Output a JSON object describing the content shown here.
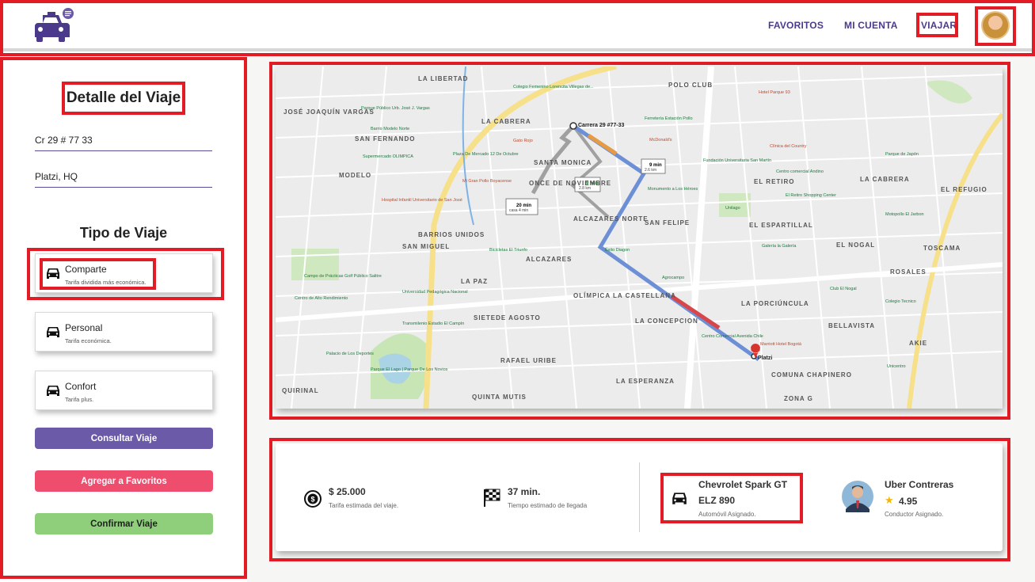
{
  "header": {
    "nav": [
      "FAVORITOS",
      "MI CUENTA",
      "VIAJAR"
    ]
  },
  "sidebar": {
    "title": "Detalle del Viaje",
    "origin": "Cr 29 # 77 33",
    "destination": "Platzi, HQ",
    "trip_type_title": "Tipo de Viaje",
    "trip_types": [
      {
        "name": "Comparte",
        "desc": "Tarifa dividida más económica."
      },
      {
        "name": "Personal",
        "desc": "Tarifa económica."
      },
      {
        "name": "Confort",
        "desc": "Tarifa plus."
      }
    ],
    "buttons": {
      "consultar": "Consultar Viaje",
      "favoritos": "Agregar a Favoritos",
      "confirmar": "Confirmar Viaje"
    },
    "colors": {
      "consultar": "#6a5aa8",
      "favoritos": "#ee4d6d",
      "confirmar": "#8fcf7c"
    }
  },
  "map": {
    "origin_label": "Carrera 29 #77-33",
    "destination_label": "Platzi",
    "route_badges": [
      {
        "time": "9 min",
        "dist": "2.6 km"
      },
      {
        "time": "9 min",
        "dist": "2.8 km"
      },
      {
        "time": "20 min",
        "dist": "casa 4 min"
      }
    ],
    "neighborhoods": [
      "LA LIBERTAD",
      "POLO CLUB",
      "JOSÉ JOAQUÍN VARGAS",
      "LA CABRERA",
      "SAN FERNANDO",
      "SANTA MONICA",
      "ONCE DE NOVIEMBRE",
      "ALCAZARES NORTE",
      "SAN FELIPE",
      "EL RETIRO",
      "LA CABRERA",
      "EL REFUGIO",
      "MODELO",
      "BARRIOS UNIDOS",
      "SAN MIGUEL",
      "ALCAZARES",
      "EL ESPARTILLAL",
      "EL NOGAL",
      "TOSCAMA",
      "ROSALES",
      "LA PAZ",
      "OLÍMPICA LA CASTELLANA",
      "LA PORCIÚNCULA",
      "SIETEDE AGOSTO",
      "LA CONCEPCION",
      "BELLAVISTA",
      "AKIE",
      "QUIRINAL",
      "RAFAEL URIBE",
      "LA ESPERANZA",
      "COMUNA CHAPINERO",
      "QUINTA MUTIS",
      "ZONA G"
    ],
    "places": [
      "Parque Público Urb. José J. Vargas",
      "Colegio Femenino Lorencita Villegas de...",
      "Barrio Modelo Norte",
      "Supermercado OLIMPICA",
      "Plaza De Mercado 12 De Octubre",
      "Mi Gran Pollo Boyacense",
      "Hospital Infantil Universitario de San José",
      "Gato Rojo",
      "Ferretería Estación Pollo",
      "McDonald's",
      "Clínica del Country",
      "Fundación Universitaria San Martín",
      "Centro comercial Andino",
      "Monumento a Los Héroes",
      "El Retiro Shopping Center",
      "Unilago",
      "Galería la Galería",
      "Bicicletas El Triunfo",
      "Éxito Diagon",
      "Agrocampo",
      "Centro de Alto Rendimiento",
      "Campo de Prácticas Golf Público Salitre",
      "Universidad Pedagógica Nacional",
      "Transmilenio Estadio El Campín",
      "Palacio de Los Deportes",
      "Parque El Lago | Parque De Los Novios",
      "Marriott Hotel Bogotá",
      "Centro Comercial Avenida Chile",
      "Club El Nogal",
      "Unicentro",
      "Hotel Parque 93",
      "Parque de Japón",
      "Colegio Tecnico",
      "Motopollo El Jarbon"
    ]
  },
  "trip_info": {
    "fare_value": "$ 25.000",
    "fare_label": "Tarifa estimada del viaje.",
    "eta_value": "37 min.",
    "eta_label": "Tiempo estimado de llegada",
    "car_model": "Chevrolet Spark GT",
    "car_plate": "ELZ 890",
    "car_label": "Automóvil Asignado.",
    "driver_name": "Uber Contreras",
    "driver_rating": "4.95",
    "driver_label": "Conductor Asignado."
  },
  "icons": [
    "taxi-logo-icon",
    "car-icon",
    "dollar-coin-icon",
    "checkered-flag-icon",
    "star-icon",
    "map-pin-icon"
  ]
}
